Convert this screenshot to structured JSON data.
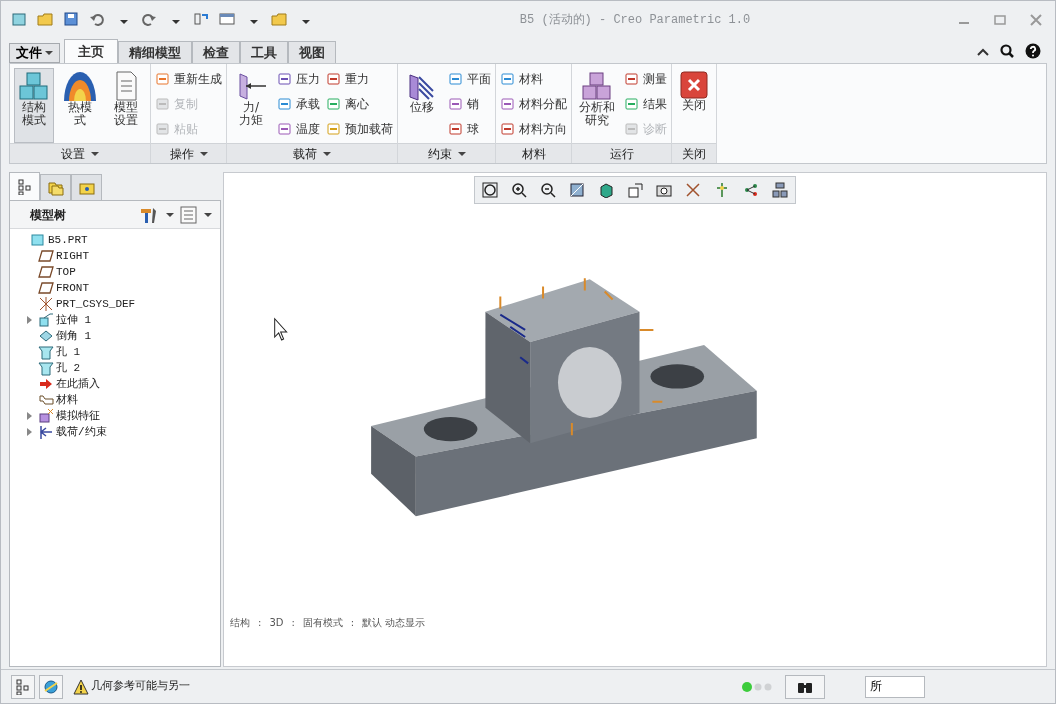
{
  "window": {
    "title": "B5 (活动的) - Creo Parametric 1.0"
  },
  "file_menu": {
    "label": "文件"
  },
  "tabs": [
    {
      "label": "主页",
      "selected": true
    },
    {
      "label": "精细模型",
      "selected": false
    },
    {
      "label": "检查",
      "selected": false
    },
    {
      "label": "工具",
      "selected": false
    },
    {
      "label": "视图",
      "selected": false
    }
  ],
  "ribbon_groups": [
    {
      "label": "设置",
      "has_menu": true,
      "items": [
        {
          "kind": "large",
          "label": "结构模式",
          "selected": true,
          "disabled": false
        },
        {
          "kind": "large",
          "label": "热模式",
          "selected": false,
          "disabled": false
        },
        {
          "kind": "large",
          "label": "模型设置",
          "selected": false,
          "disabled": false
        }
      ]
    },
    {
      "label": "操作",
      "has_menu": true,
      "items": [
        {
          "kind": "small",
          "label": "重新生成",
          "selected": false,
          "disabled": false
        },
        {
          "kind": "small",
          "label": "复制",
          "selected": false,
          "disabled": true
        },
        {
          "kind": "small",
          "label": "粘贴",
          "selected": false,
          "disabled": true
        }
      ]
    },
    {
      "label": "载荷",
      "has_menu": true,
      "items": [
        {
          "kind": "large",
          "label": "力/力矩",
          "selected": false,
          "disabled": false
        },
        {
          "kind": "small",
          "label": "压力",
          "selected": false,
          "disabled": false
        },
        {
          "kind": "small",
          "label": "承载",
          "selected": false,
          "disabled": false
        },
        {
          "kind": "small",
          "label": "温度",
          "selected": false,
          "disabled": false
        },
        {
          "kind": "small",
          "label": "重力",
          "selected": false,
          "disabled": false
        },
        {
          "kind": "small",
          "label": "离心",
          "selected": false,
          "disabled": false
        },
        {
          "kind": "small",
          "label": "预加载荷",
          "selected": false,
          "disabled": false
        }
      ]
    },
    {
      "label": "约束",
      "has_menu": true,
      "items": [
        {
          "kind": "large",
          "label": "位移",
          "selected": false,
          "disabled": false
        },
        {
          "kind": "small",
          "label": "平面",
          "selected": false,
          "disabled": false
        },
        {
          "kind": "small",
          "label": "销",
          "selected": false,
          "disabled": false
        },
        {
          "kind": "small",
          "label": "球",
          "selected": false,
          "disabled": false
        }
      ]
    },
    {
      "label": "材料",
      "has_menu": false,
      "items": [
        {
          "kind": "small",
          "label": "材料",
          "selected": false,
          "disabled": false
        },
        {
          "kind": "small",
          "label": "材料分配",
          "selected": false,
          "disabled": false
        },
        {
          "kind": "small",
          "label": "材料方向",
          "selected": false,
          "disabled": false
        }
      ]
    },
    {
      "label": "运行",
      "has_menu": false,
      "items": [
        {
          "kind": "large",
          "label": "分析和研究",
          "selected": false,
          "disabled": false
        },
        {
          "kind": "small",
          "label": "测量",
          "selected": false,
          "disabled": false
        },
        {
          "kind": "small",
          "label": "结果",
          "selected": false,
          "disabled": false
        },
        {
          "kind": "small",
          "label": "诊断",
          "selected": false,
          "disabled": true
        }
      ]
    },
    {
      "label": "关闭",
      "has_menu": false,
      "items": [
        {
          "kind": "large",
          "label": "关闭",
          "selected": false,
          "disabled": false
        }
      ]
    }
  ],
  "navigator_tabs": [
    {
      "selected": true
    },
    {
      "selected": false
    },
    {
      "selected": false
    }
  ],
  "model_tree": {
    "title": "模型树",
    "items": [
      {
        "label": "B5.PRT",
        "children": [
          {
            "label": "RIGHT"
          },
          {
            "label": "TOP"
          },
          {
            "label": "FRONT"
          },
          {
            "label": "PRT_CSYS_DEF"
          },
          {
            "label": "拉伸 1",
            "expanded": false
          },
          {
            "label": "倒角 1"
          },
          {
            "label": "孔 1"
          },
          {
            "label": "孔 2"
          },
          {
            "label": "在此插入"
          },
          {
            "label": "材料"
          },
          {
            "label": "模拟特征",
            "expanded": false
          },
          {
            "label": "载荷/约束",
            "expanded": false
          }
        ]
      }
    ]
  },
  "graphics_status": [
    "结构",
    ":",
    "3D",
    ":",
    "固有模式",
    ":",
    "默认 动态显示"
  ],
  "status_bar": {
    "message": "几何参考可能与另一",
    "filter": "所"
  }
}
